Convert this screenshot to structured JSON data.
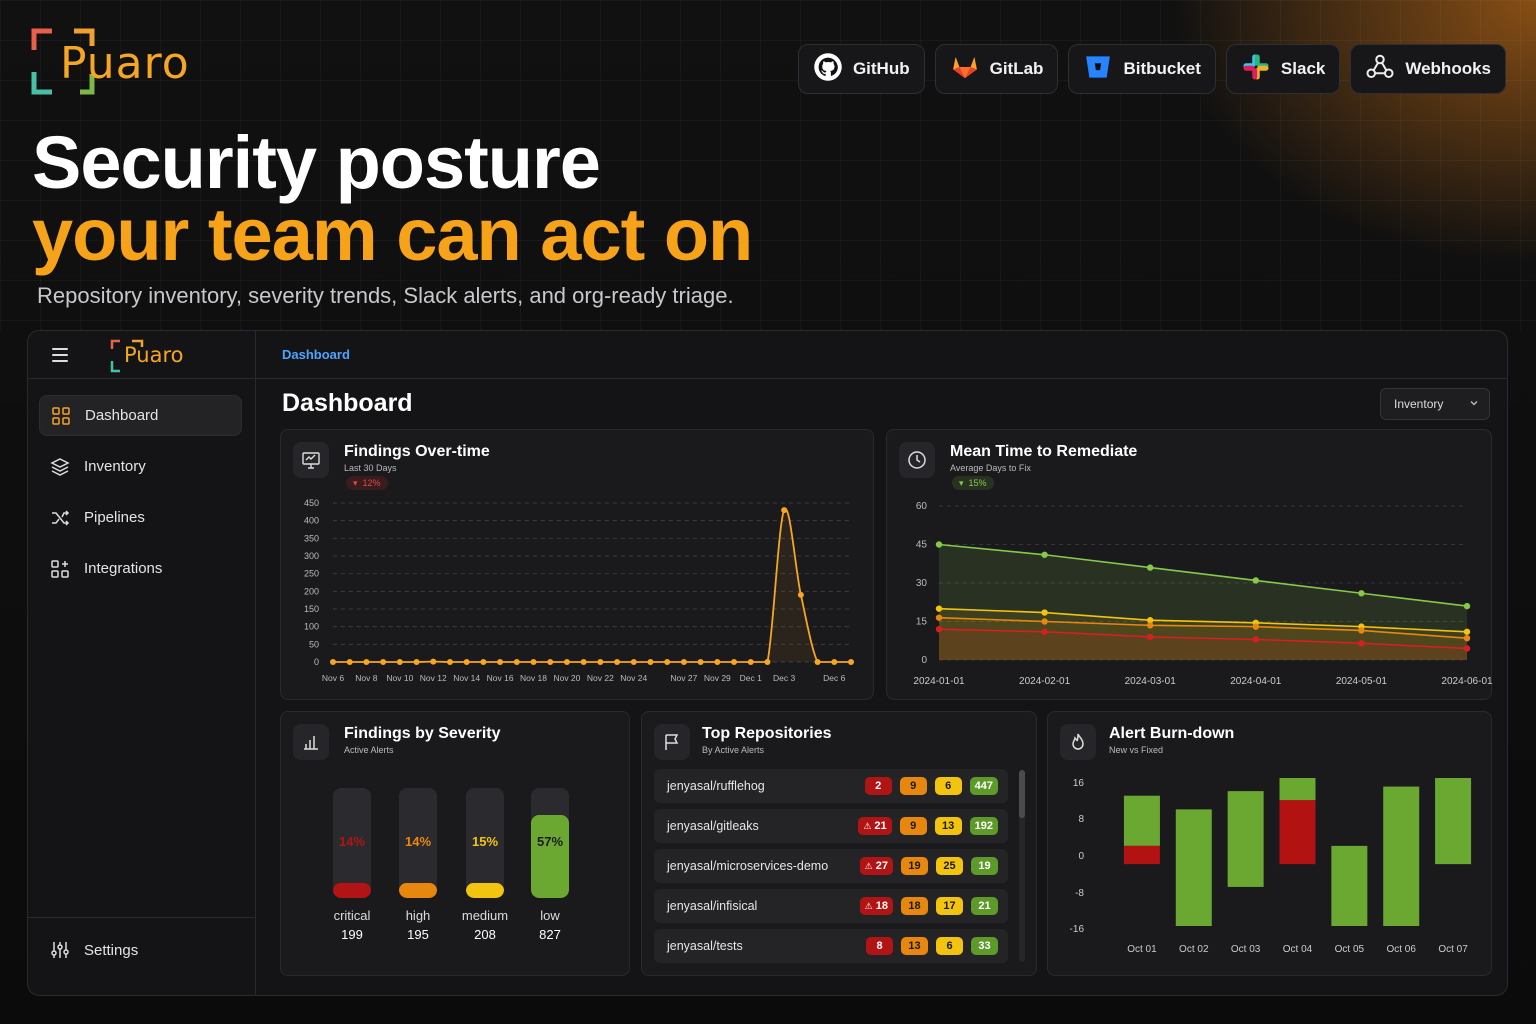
{
  "brand": {
    "name": "Puaro"
  },
  "integrations": [
    {
      "label": "GitHub",
      "icon": "github-icon"
    },
    {
      "label": "GitLab",
      "icon": "gitlab-icon"
    },
    {
      "label": "Bitbucket",
      "icon": "bitbucket-icon"
    },
    {
      "label": "Slack",
      "icon": "slack-icon"
    },
    {
      "label": "Webhooks",
      "icon": "webhooks-icon"
    }
  ],
  "hero": {
    "line1": "Security posture",
    "line2": "your team can act on",
    "subtitle": "Repository inventory, severity trends, Slack alerts, and org-ready triage."
  },
  "colors": {
    "accent": "#f7a31a",
    "critical": "#b11414",
    "high": "#e8870e",
    "medium": "#f2c40f",
    "low": "#5e9a2a",
    "link": "#4ea3ff"
  },
  "sidebar": {
    "items": [
      {
        "label": "Dashboard",
        "icon": "grid-icon",
        "active": true
      },
      {
        "label": "Inventory",
        "icon": "layers-icon",
        "active": false
      },
      {
        "label": "Pipelines",
        "icon": "shuffle-icon",
        "active": false
      },
      {
        "label": "Integrations",
        "icon": "add-grid-icon",
        "active": false
      }
    ],
    "settings_label": "Settings"
  },
  "main": {
    "breadcrumb": "Dashboard",
    "title": "Dashboard",
    "view_select": {
      "value": "Inventory"
    }
  },
  "findings_over_time": {
    "title": "Findings Over-time",
    "subtitle": "Last 30 Days",
    "delta": "12%",
    "delta_direction": "up"
  },
  "mttr": {
    "title": "Mean Time to Remediate",
    "subtitle": "Average Days to Fix",
    "delta": "15%",
    "delta_direction": "down"
  },
  "severity": {
    "title": "Findings by Severity",
    "subtitle": "Active Alerts",
    "items": [
      {
        "label": "critical",
        "count": "199",
        "pct": "14%",
        "fraction": 0.14,
        "color": "#b11414"
      },
      {
        "label": "high",
        "count": "195",
        "pct": "14%",
        "fraction": 0.14,
        "color": "#e8870e"
      },
      {
        "label": "medium",
        "count": "208",
        "pct": "15%",
        "fraction": 0.15,
        "color": "#f2c40f"
      },
      {
        "label": "low",
        "count": "827",
        "pct": "57%",
        "fraction": 0.57,
        "color": "#6aa832"
      }
    ]
  },
  "top_repos": {
    "title": "Top Repositories",
    "subtitle": "By Active Alerts",
    "rows": [
      {
        "name": "jenyasal/rufflehog",
        "critical": "2",
        "critical_warn": false,
        "high": "9",
        "medium": "6",
        "low": "447"
      },
      {
        "name": "jenyasal/gitleaks",
        "critical": "21",
        "critical_warn": true,
        "high": "9",
        "medium": "13",
        "low": "192"
      },
      {
        "name": "jenyasal/microservices-demo",
        "critical": "27",
        "critical_warn": true,
        "high": "19",
        "medium": "25",
        "low": "19"
      },
      {
        "name": "jenyasal/infisical",
        "critical": "18",
        "critical_warn": true,
        "high": "18",
        "medium": "17",
        "low": "21"
      },
      {
        "name": "jenyasal/tests",
        "critical": "8",
        "critical_warn": false,
        "high": "13",
        "medium": "6",
        "low": "33"
      }
    ]
  },
  "burndown": {
    "title": "Alert Burn-down",
    "subtitle": "New vs Fixed"
  },
  "chart_data": [
    {
      "type": "line",
      "title": "Findings Over-time",
      "x": [
        "Nov 6",
        "Nov 7",
        "Nov 8",
        "Nov 9",
        "Nov 10",
        "Nov 11",
        "Nov 12",
        "Nov 13",
        "Nov 14",
        "Nov 15",
        "Nov 16",
        "Nov 17",
        "Nov 18",
        "Nov 19",
        "Nov 20",
        "Nov 21",
        "Nov 22",
        "Nov 23",
        "Nov 24",
        "Nov 25",
        "Nov 26",
        "Nov 27",
        "Nov 28",
        "Nov 29",
        "Nov 30",
        "Dec 1",
        "Dec 2",
        "Dec 3",
        "Dec 4",
        "Dec 5",
        "Dec 6"
      ],
      "x_tick_labels": [
        "Nov 6",
        "Nov 8",
        "Nov 10",
        "Nov 12",
        "Nov 14",
        "Nov 16",
        "Nov 18",
        "Nov 20",
        "Nov 22",
        "Nov 24",
        "Nov 27",
        "Nov 29",
        "Dec 1",
        "Dec 3",
        "Dec 6"
      ],
      "series": [
        {
          "color": "#f5a623",
          "values": [
            0,
            0,
            0,
            0,
            0,
            0,
            1,
            0,
            0,
            0,
            0,
            0,
            0,
            0,
            0,
            0,
            0,
            0,
            0,
            0,
            0,
            0,
            0,
            0,
            0,
            0,
            0,
            430,
            190,
            0,
            0,
            0
          ]
        }
      ],
      "ylim": [
        0,
        450
      ],
      "yticks": [
        0,
        50,
        100,
        150,
        200,
        250,
        300,
        350,
        400,
        450
      ],
      "grid": true
    },
    {
      "type": "line",
      "title": "Mean Time to Remediate",
      "x": [
        "2024-01-01",
        "2024-02-01",
        "2024-03-01",
        "2024-04-01",
        "2024-05-01",
        "2024-06-01"
      ],
      "series": [
        {
          "color": "#86c94a",
          "values": [
            45,
            41,
            36,
            31,
            26,
            21
          ]
        },
        {
          "color": "#f2c40f",
          "values": [
            20,
            18.5,
            15.5,
            14.5,
            13,
            11
          ]
        },
        {
          "color": "#e8870e",
          "values": [
            16.5,
            15,
            13.5,
            13,
            11.5,
            8.5
          ]
        },
        {
          "color": "#d42020",
          "values": [
            12,
            11,
            9,
            8,
            6.5,
            4.5
          ]
        }
      ],
      "ylim": [
        0,
        60
      ],
      "yticks": [
        0,
        15,
        30,
        45,
        60
      ],
      "grid": true
    },
    {
      "type": "bar",
      "title": "Alert Burn-down",
      "categories": [
        "Oct 01",
        "Oct 02",
        "Oct 03",
        "Oct 04",
        "Oct 05",
        "Oct 06",
        "Oct 07"
      ],
      "segments": [
        {
          "green": [
            2,
            13
          ],
          "red": [
            -2,
            2
          ]
        },
        {
          "green": [
            -24,
            10
          ],
          "red": null
        },
        {
          "green": [
            -7,
            14
          ],
          "red": null
        },
        {
          "green": [
            12,
            18
          ],
          "red": [
            -2,
            12
          ]
        },
        {
          "green": [
            -19,
            2
          ],
          "red": null
        },
        {
          "green": [
            -32,
            15
          ],
          "red": null
        },
        {
          "green": [
            -2,
            17
          ],
          "red": null
        }
      ],
      "ylim": [
        -16,
        16
      ],
      "yticks": [
        16,
        8,
        0,
        -8,
        -16
      ],
      "grid": false
    }
  ]
}
